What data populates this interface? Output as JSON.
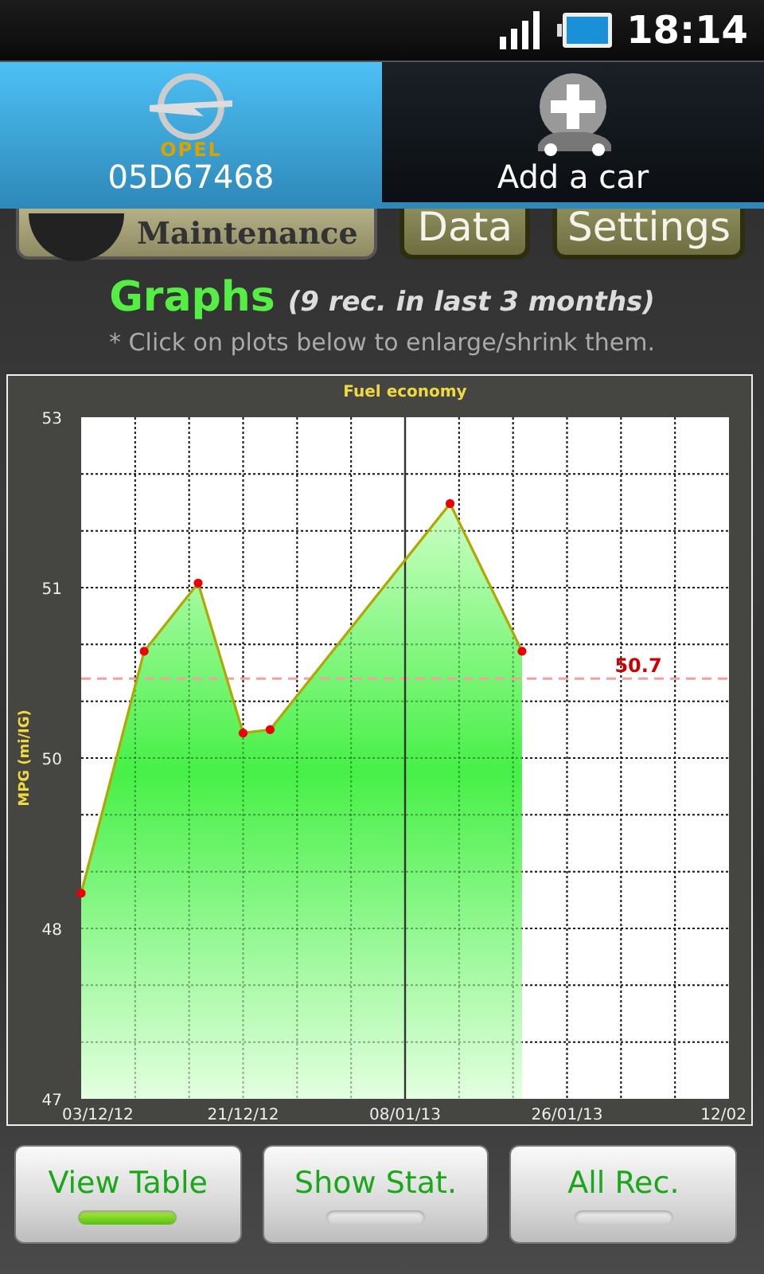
{
  "status_bar": {
    "time": "18:14"
  },
  "car_tabs": [
    {
      "kind": "car",
      "brand": "OPEL",
      "label": "05D67468",
      "selected": true
    },
    {
      "kind": "add",
      "label": "Add a car",
      "selected": false
    }
  ],
  "menu_buttons": [
    {
      "kind": "emblem",
      "label": "Maintenance"
    },
    {
      "kind": "plain",
      "label": "Data"
    },
    {
      "kind": "plain",
      "label": "Settings"
    }
  ],
  "heading": {
    "title": "Graphs",
    "subtitle": "(9 rec. in last 3 months)",
    "hint": "* Click on plots below to enlarge/shrink them."
  },
  "chart_data": {
    "type": "area",
    "title": "Fuel economy",
    "ylabel": "MPG (mi/IG)",
    "x": [
      "2012-12-03",
      "2012-12-10",
      "2012-12-16",
      "2012-12-21",
      "2012-12-24",
      "2013-01-13",
      "2013-01-21"
    ],
    "series": [
      {
        "color": "#33ee33",
        "values": [
          48.81,
          50.94,
          51.54,
          50.22,
          50.25,
          52.24,
          50.94
        ]
      }
    ],
    "xlim": [
      "2012-12-03",
      "2013-02-13"
    ],
    "ylim": [
      47,
      53
    ],
    "xticks": [
      {
        "value": "2012-12-03",
        "label": "03/12/12"
      },
      {
        "value": "2012-12-21",
        "label": "21/12/12"
      },
      {
        "value": "2013-01-08",
        "label": "08/01/13"
      },
      {
        "value": "2013-01-26",
        "label": "26/01/13"
      },
      {
        "value": "2013-02-13",
        "label": "12/02"
      }
    ],
    "yticks": [
      {
        "value": 47,
        "label": "47"
      },
      {
        "value": 48.5,
        "label": "48"
      },
      {
        "value": 50,
        "label": "50"
      },
      {
        "value": 51.5,
        "label": "51"
      },
      {
        "value": 53,
        "label": "53"
      }
    ],
    "grid": true,
    "ref_lines": [
      {
        "axis": "y",
        "value": 50.7,
        "label": "50.7"
      },
      {
        "axis": "x",
        "value": "2013-01-08"
      }
    ]
  },
  "bottom_buttons": [
    {
      "label": "View Table",
      "on": true
    },
    {
      "label": "Show Stat.",
      "on": false
    },
    {
      "label": "All Rec.",
      "on": false
    }
  ]
}
